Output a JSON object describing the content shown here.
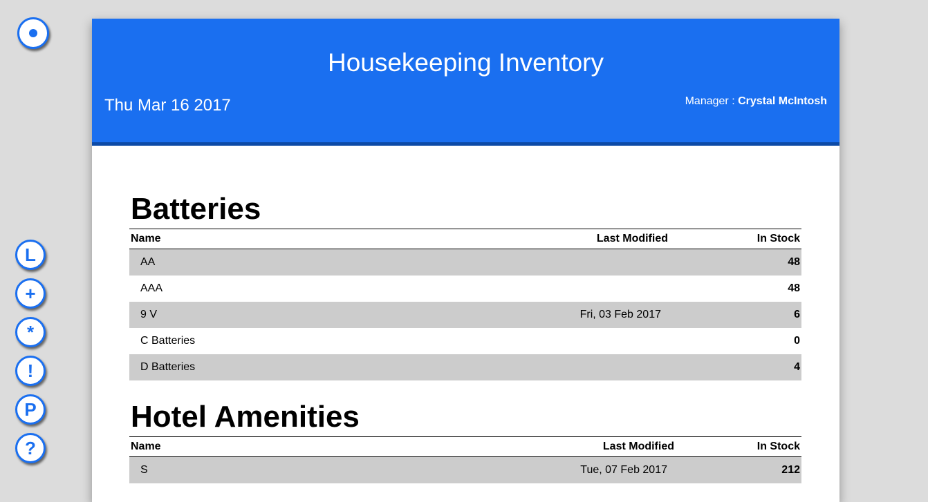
{
  "header": {
    "title": "Housekeeping Inventory",
    "date": "Thu Mar 16 2017",
    "manager_label": "Manager : ",
    "manager_name": "Crystal McIntosh"
  },
  "side_buttons": [
    "L",
    "+",
    "*",
    "!",
    "P",
    "?"
  ],
  "columns": {
    "name": "Name",
    "last_modified": "Last Modified",
    "in_stock": "In Stock"
  },
  "sections": [
    {
      "title": "Batteries",
      "rows": [
        {
          "name": "AA",
          "modified": "",
          "stock": "48"
        },
        {
          "name": "AAA",
          "modified": "",
          "stock": "48"
        },
        {
          "name": "9 V",
          "modified": "Fri, 03 Feb 2017",
          "stock": "6"
        },
        {
          "name": "C Batteries",
          "modified": "",
          "stock": "0"
        },
        {
          "name": "D Batteries",
          "modified": "",
          "stock": "4"
        }
      ]
    },
    {
      "title": "Hotel Amenities",
      "rows": [
        {
          "name": "S",
          "modified": "Tue, 07 Feb 2017",
          "stock": "212"
        }
      ]
    }
  ],
  "colors": {
    "accent": "#1a6ff0",
    "header_border": "#0c4aa6",
    "row_alt": "#cccccc",
    "background": "#dcdcdc"
  }
}
